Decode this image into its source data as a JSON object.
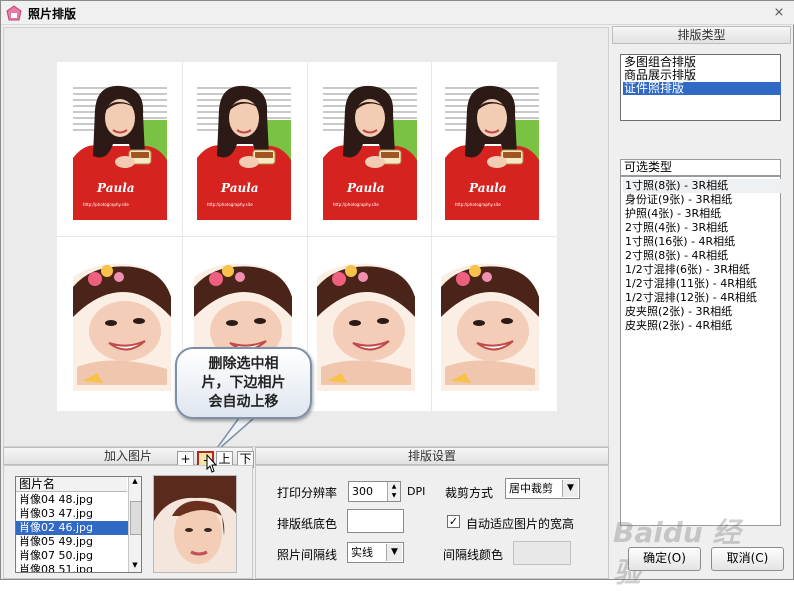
{
  "window": {
    "title": "照片排版",
    "close_glyph": "⨯"
  },
  "annotation": {
    "callout_text": [
      "删除选中相",
      "片，下边相片",
      "会自动上移"
    ]
  },
  "add_photo": {
    "section_title": "加入图片",
    "buttons": {
      "add": "+",
      "delete": "-",
      "up": "上",
      "down": "下"
    },
    "file_list": {
      "header": "图片名",
      "items": [
        "肖像04 48.jpg",
        "肖像03 47.jpg",
        "肖像02 46.jpg",
        "肖像05 49.jpg",
        "肖像07 50.jpg",
        "肖像08 51.jpg"
      ],
      "selected_index": 2
    }
  },
  "layout_settings": {
    "section_title": "排版设置",
    "resolution_label": "打印分辨率",
    "resolution_value": "300",
    "resolution_unit": "DPI",
    "crop_label": "裁剪方式",
    "crop_value": "居中裁剪",
    "paper_color_label": "排版纸底色",
    "auto_fit_label": "自动适应图片的宽高",
    "auto_fit_checked": true,
    "spacing_label": "照片间隔线",
    "spacing_value": "实线",
    "line_color_label": "间隔线颜色"
  },
  "layout_type": {
    "section_title": "排版类型",
    "types": [
      "多图组合排版",
      "商品展示排版",
      "证件照排版"
    ],
    "selected_index": 2,
    "available_header": "可选类型",
    "available": [
      "1寸照(8张) - 3R相纸",
      "身份证(9张) - 3R相纸",
      "护照(4张) - 3R相纸",
      "2寸照(4张) - 3R相纸",
      "1寸照(16张) - 4R相纸",
      "2寸照(8张) - 4R相纸",
      "1/2寸混排(6张) - 3R相纸",
      "1/2寸混排(11张) - 4R相纸",
      "1/2寸混排(12张) - 4R相纸",
      "皮夹照(2张) - 3R相纸",
      "皮夹照(2张) - 4R相纸"
    ],
    "highlighted_index": 0
  },
  "footer": {
    "ok_label": "确定(O)",
    "cancel_label": "取消(C)"
  },
  "watermark": "Baidu 经验",
  "photo_labels": {
    "name": "Paula",
    "caption": "http://photography.site"
  }
}
